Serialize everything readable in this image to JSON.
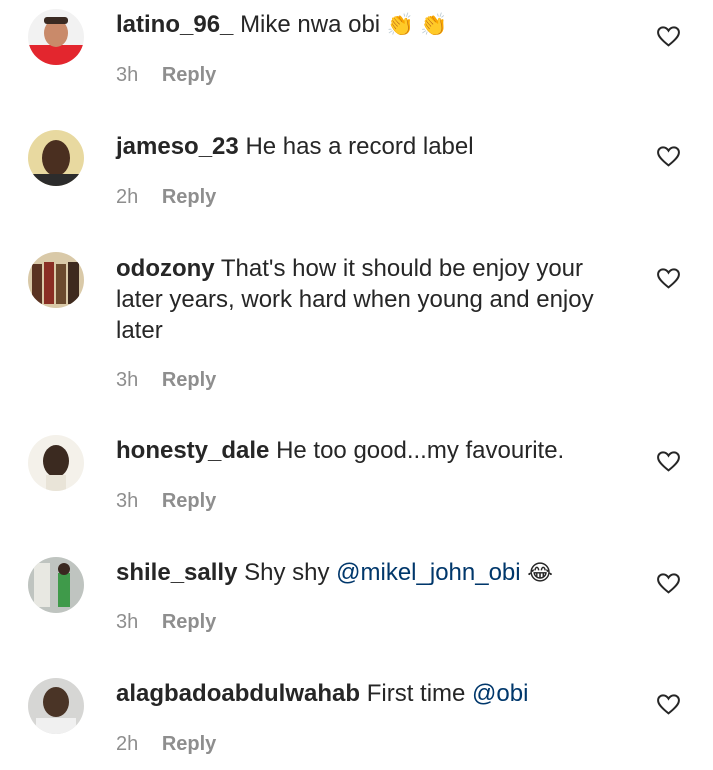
{
  "reply_label": "Reply",
  "comments": [
    {
      "username": "latino_96_",
      "text": "Mike nwa obi",
      "emoji": "👏 👏",
      "time": "3h"
    },
    {
      "username": "jameso_23",
      "text": "He has a record label",
      "time": "2h"
    },
    {
      "username": "odozony",
      "text": "That's how it should be enjoy your later years, work hard when young and enjoy later",
      "time": "3h"
    },
    {
      "username": "honesty_dale",
      "text": "He too good...my favourite.",
      "time": "3h"
    },
    {
      "username": "shile_sally",
      "text": "Shy shy",
      "mention": "@mikel_john_obi",
      "emoji": "😂",
      "time": "3h"
    },
    {
      "username": "alagbadoabdulwahab",
      "text": "First time",
      "mention": "@obi",
      "time": "2h"
    }
  ],
  "colors": {
    "text": "#262626",
    "meta": "#8e8e8e",
    "mention": "#00376b"
  },
  "icons": {
    "like": "heart-outline-icon"
  }
}
